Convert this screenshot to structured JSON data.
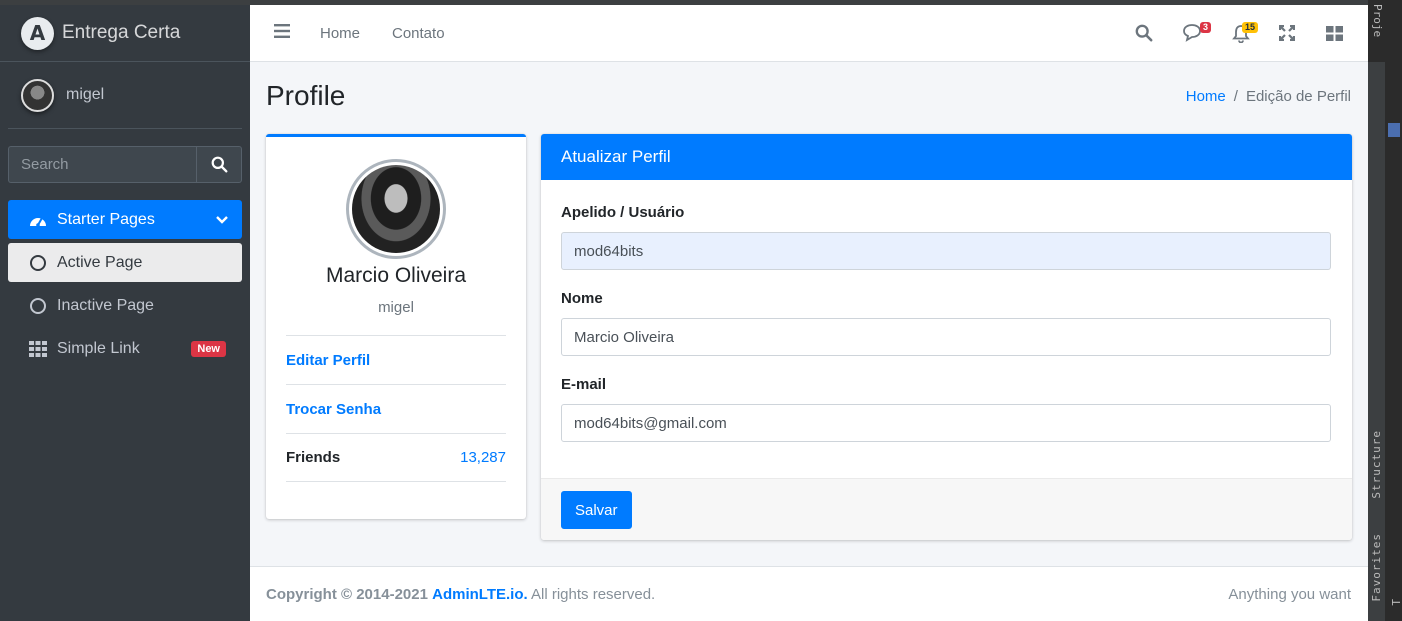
{
  "brand": {
    "name": "Entrega Certa",
    "logo_letter": "A"
  },
  "user": {
    "name": "migel"
  },
  "sidebar_search": {
    "placeholder": "Search"
  },
  "sidebar": {
    "items": [
      {
        "label": "Starter Pages",
        "icon": "tachometer-icon",
        "state": "active"
      },
      {
        "label": "Active Page",
        "icon": "circle-icon",
        "state": "sub-active"
      },
      {
        "label": "Inactive Page",
        "icon": "circle-icon",
        "state": "normal"
      },
      {
        "label": "Simple Link",
        "icon": "grid-icon",
        "state": "normal",
        "badge": "New"
      }
    ]
  },
  "topbar": {
    "links": [
      "Home",
      "Contato"
    ],
    "messages_badge": "3",
    "notifications_badge": "15"
  },
  "content": {
    "title": "Profile",
    "breadcrumb": {
      "home": "Home",
      "sep": "/",
      "current": "Edição de Perfil"
    }
  },
  "profile_card": {
    "name": "Marcio Oliveira",
    "username": "migel",
    "edit_link": "Editar Perfil",
    "password_link": "Trocar Senha",
    "friends_label": "Friends",
    "friends_count": "13,287"
  },
  "form": {
    "title": "Atualizar Perfil",
    "fields": [
      {
        "label": "Apelido / Usuário",
        "value": "mod64bits"
      },
      {
        "label": "Nome",
        "value": "Marcio Oliveira"
      },
      {
        "label": "E-mail",
        "value": "mod64bits@gmail.com"
      }
    ],
    "submit": "Salvar"
  },
  "footer": {
    "copyright_prefix": "Copyright © 2014-2021",
    "brand_link": "AdminLTE.io.",
    "rights": "All rights reserved.",
    "right_text": "Anything you want"
  },
  "ide": {
    "tab_project": "Proje",
    "tab_structure": "Structure",
    "tab_favorites": "Favorites",
    "tab_t": "T"
  },
  "colors": {
    "primary": "#007bff",
    "sidebar": "#343a40",
    "danger": "#dc3545",
    "warning": "#ffc107"
  }
}
